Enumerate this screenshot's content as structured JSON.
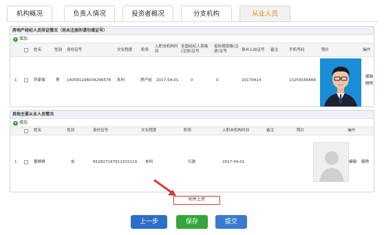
{
  "tabs": [
    "机构概况",
    "负责人情况",
    "投资者概况",
    "分支机构",
    "从业人员"
  ],
  "section1": {
    "title": "房地产经纪人员持证情况（尚未注册的请勿填证号）",
    "add_label": "增加",
    "headers": [
      "姓名",
      "性别",
      "身份证号",
      "文化程度",
      "职务",
      "入职本机构时间",
      "全国经纪人资格(注册)证号",
      "省协理资格(注册)证号",
      "泉州上岗证号",
      "备注",
      "手机号码",
      "照片",
      "操作"
    ],
    "row": {
      "index": "1",
      "name": "符家俊",
      "gender": "男",
      "id": "140581198004296578",
      "education": "本科",
      "position": "房产经",
      "join_date": "2017-04-01",
      "national_cert": "0",
      "province_cert": "0",
      "local_cert": "20170414",
      "remark": "",
      "phone": "13255556666",
      "edit": "编辑",
      "delete": "删除"
    }
  },
  "section2": {
    "title": "其他主要从业人员情况",
    "add_label": "增加",
    "headers": [
      "姓名",
      "性别",
      "身份证号",
      "文化程度",
      "职务",
      "入职本机构时间",
      "备注",
      "照片",
      "操作"
    ],
    "row": {
      "index": "1",
      "name": "黄婷婷",
      "gender": "女",
      "id": "652827197912315119",
      "education": "本科",
      "position": "行政",
      "join_date": "2017-04-01",
      "remark": "",
      "edit": "编辑",
      "delete": "删除"
    }
  },
  "upload_label": "附件上传",
  "buttons": {
    "prev": "上一步",
    "save": "保存",
    "submit": "提交"
  },
  "colors": {
    "active_tab_text": "#e8880e",
    "prev": "#2c6fc8",
    "save": "#32a63b",
    "submit": "#3a7bd0",
    "highlight": "#d23b30"
  }
}
